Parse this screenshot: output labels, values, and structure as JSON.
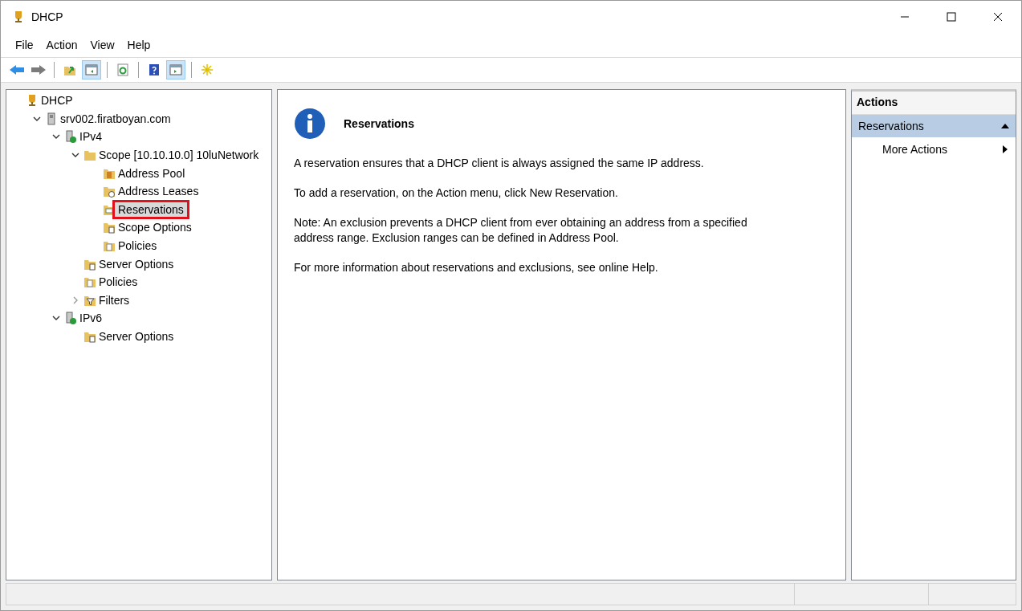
{
  "window": {
    "title": "DHCP"
  },
  "menu": [
    "File",
    "Action",
    "View",
    "Help"
  ],
  "toolbar": [
    {
      "kind": "back",
      "pressed": false
    },
    {
      "kind": "forward",
      "pressed": false
    },
    {
      "kind": "sep"
    },
    {
      "kind": "up",
      "pressed": false
    },
    {
      "kind": "tree",
      "pressed": true
    },
    {
      "kind": "sep"
    },
    {
      "kind": "refresh",
      "pressed": false
    },
    {
      "kind": "sep"
    },
    {
      "kind": "help",
      "pressed": false
    },
    {
      "kind": "pane",
      "pressed": true
    },
    {
      "kind": "sep"
    },
    {
      "kind": "star",
      "pressed": false
    }
  ],
  "tree": [
    {
      "label": "DHCP",
      "kind": "root",
      "selected": false,
      "children": [
        {
          "label": "srv002.firatboyan.com",
          "kind": "server",
          "expanded": true,
          "selected": false,
          "children": [
            {
              "label": "IPv4",
              "kind": "ip",
              "expanded": true,
              "selected": false,
              "children": [
                {
                  "label": "Scope [10.10.10.0] 10luNetwork",
                  "kind": "folder",
                  "expanded": true,
                  "selected": false,
                  "children": [
                    {
                      "label": "Address Pool",
                      "kind": "pool",
                      "selected": false
                    },
                    {
                      "label": "Address Leases",
                      "kind": "leases",
                      "selected": false
                    },
                    {
                      "label": "Reservations",
                      "kind": "reservations",
                      "selected": true
                    },
                    {
                      "label": "Scope Options",
                      "kind": "options",
                      "selected": false
                    },
                    {
                      "label": "Policies",
                      "kind": "policies",
                      "selected": false
                    }
                  ]
                },
                {
                  "label": "Server Options",
                  "kind": "options",
                  "selected": false
                },
                {
                  "label": "Policies",
                  "kind": "policies",
                  "selected": false
                },
                {
                  "label": "Filters",
                  "kind": "filters",
                  "expanded": false,
                  "selected": false
                }
              ]
            },
            {
              "label": "IPv6",
              "kind": "ip",
              "expanded": true,
              "selected": false,
              "children": [
                {
                  "label": "Server Options",
                  "kind": "options",
                  "selected": false
                }
              ]
            }
          ]
        }
      ]
    }
  ],
  "content": {
    "title": "Reservations",
    "paragraphs": [
      "A reservation ensures that a DHCP client is always assigned the same IP address.",
      "To add a reservation, on the Action menu, click New Reservation.",
      "Note: An exclusion prevents a DHCP client from ever obtaining an address from a specified address range.  Exclusion ranges can be defined in Address Pool.",
      "For more information about reservations and exclusions, see online Help."
    ]
  },
  "actions": {
    "title": "Actions",
    "section": {
      "label": "Reservations",
      "expanded": true
    },
    "items": [
      "More Actions"
    ]
  }
}
